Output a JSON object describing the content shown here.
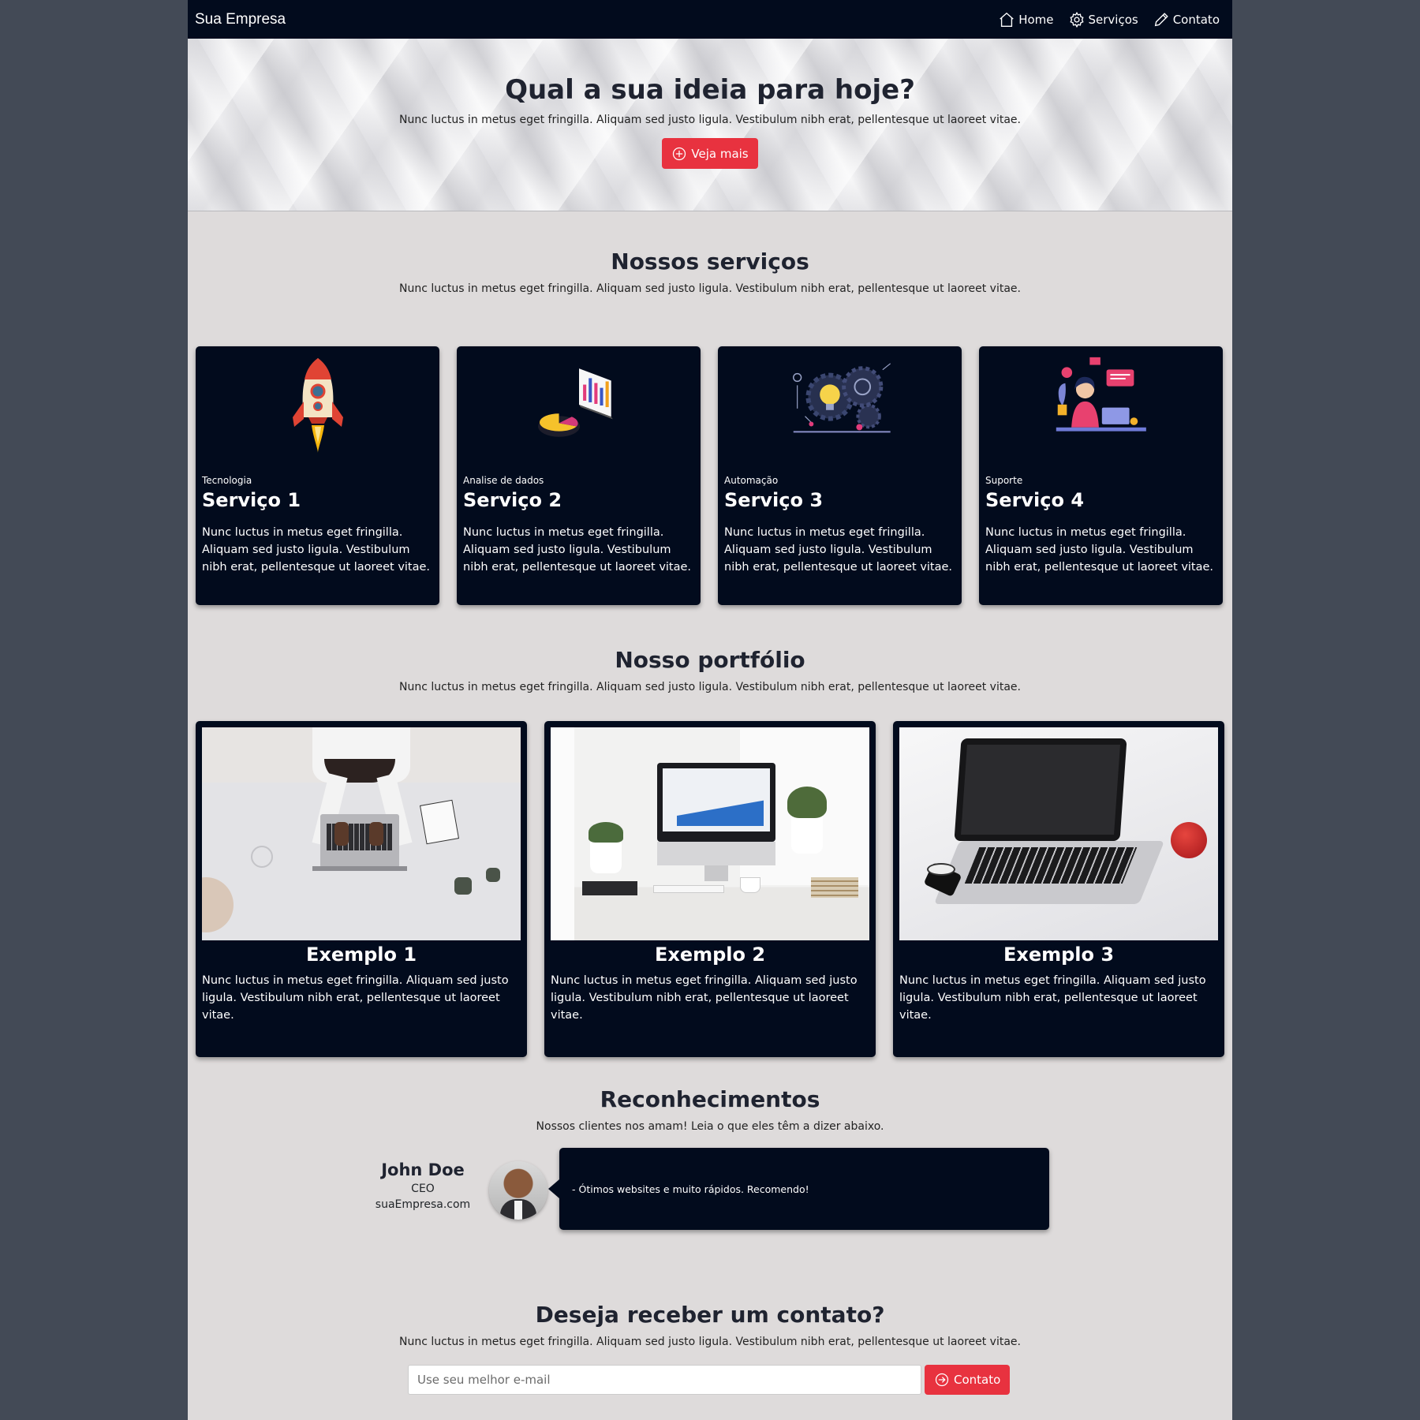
{
  "navbar": {
    "brand": "Sua Empresa",
    "links": [
      {
        "label": "Home",
        "icon": "home-icon"
      },
      {
        "label": "Serviços",
        "icon": "gear-icon"
      },
      {
        "label": "Contato",
        "icon": "pencil-icon"
      }
    ]
  },
  "hero": {
    "title": "Qual a sua ideia para hoje?",
    "subtitle": "Nunc luctus in metus eget fringilla. Aliquam sed justo ligula. Vestibulum nibh erat, pellentesque ut laoreet vitae.",
    "button": "Veja mais"
  },
  "services": {
    "title": "Nossos serviços",
    "subtitle": "Nunc luctus in metus eget fringilla. Aliquam sed justo ligula. Vestibulum nibh erat, pellentesque ut laoreet vitae.",
    "cards": [
      {
        "category": "Tecnologia",
        "title": "Serviço 1",
        "text": "Nunc luctus in metus eget fringilla. Aliquam sed justo ligula. Vestibulum nibh erat, pellentesque ut laoreet vitae.",
        "icon": "rocket-icon"
      },
      {
        "category": "Analise de dados",
        "title": "Serviço 2",
        "text": "Nunc luctus in metus eget fringilla. Aliquam sed justo ligula. Vestibulum nibh erat, pellentesque ut laoreet vitae.",
        "icon": "data-chart-icon"
      },
      {
        "category": "Automação",
        "title": "Serviço 3",
        "text": "Nunc luctus in metus eget fringilla. Aliquam sed justo ligula. Vestibulum nibh erat, pellentesque ut laoreet vitae.",
        "icon": "gears-lightbulb-icon"
      },
      {
        "category": "Suporte",
        "title": "Serviço 4",
        "text": "Nunc luctus in metus eget fringilla. Aliquam sed justo ligula. Vestibulum nibh erat, pellentesque ut laoreet vitae.",
        "icon": "support-person-icon"
      }
    ]
  },
  "portfolio": {
    "title": "Nosso portfólio",
    "subtitle": "Nunc luctus in metus eget fringilla. Aliquam sed justo ligula. Vestibulum nibh erat, pellentesque ut laoreet vitae.",
    "items": [
      {
        "title": "Exemplo 1",
        "text": "Nunc luctus in metus eget fringilla. Aliquam sed justo ligula. Vestibulum nibh erat, pellentesque ut laoreet vitae."
      },
      {
        "title": "Exemplo 2",
        "text": "Nunc luctus in metus eget fringilla. Aliquam sed justo ligula. Vestibulum nibh erat, pellentesque ut laoreet vitae."
      },
      {
        "title": "Exemplo 3",
        "text": "Nunc luctus in metus eget fringilla. Aliquam sed justo ligula. Vestibulum nibh erat, pellentesque ut laoreet vitae."
      }
    ]
  },
  "recognition": {
    "title": "Reconhecimentos",
    "subtitle": "Nossos clientes nos amam! Leia o que eles têm a dizer abaixo.",
    "testimonial": {
      "name": "John Doe",
      "role": "CEO",
      "site": "suaEmpresa.com",
      "quote": "- Ótimos websites e muito rápidos. Recomendo!"
    }
  },
  "contact": {
    "title": "Deseja receber um contato?",
    "subtitle": "Nunc luctus in metus eget fringilla. Aliquam sed justo ligula. Vestibulum nibh erat, pellentesque ut laoreet vitae.",
    "email_placeholder": "Use seu melhor e-mail",
    "email_value": "",
    "button": "Contato"
  },
  "colors": {
    "dark_navy": "#020b1d",
    "accent_red": "#e8323f",
    "page_bg": "#dedbdb",
    "outer_bg": "#434a56"
  }
}
